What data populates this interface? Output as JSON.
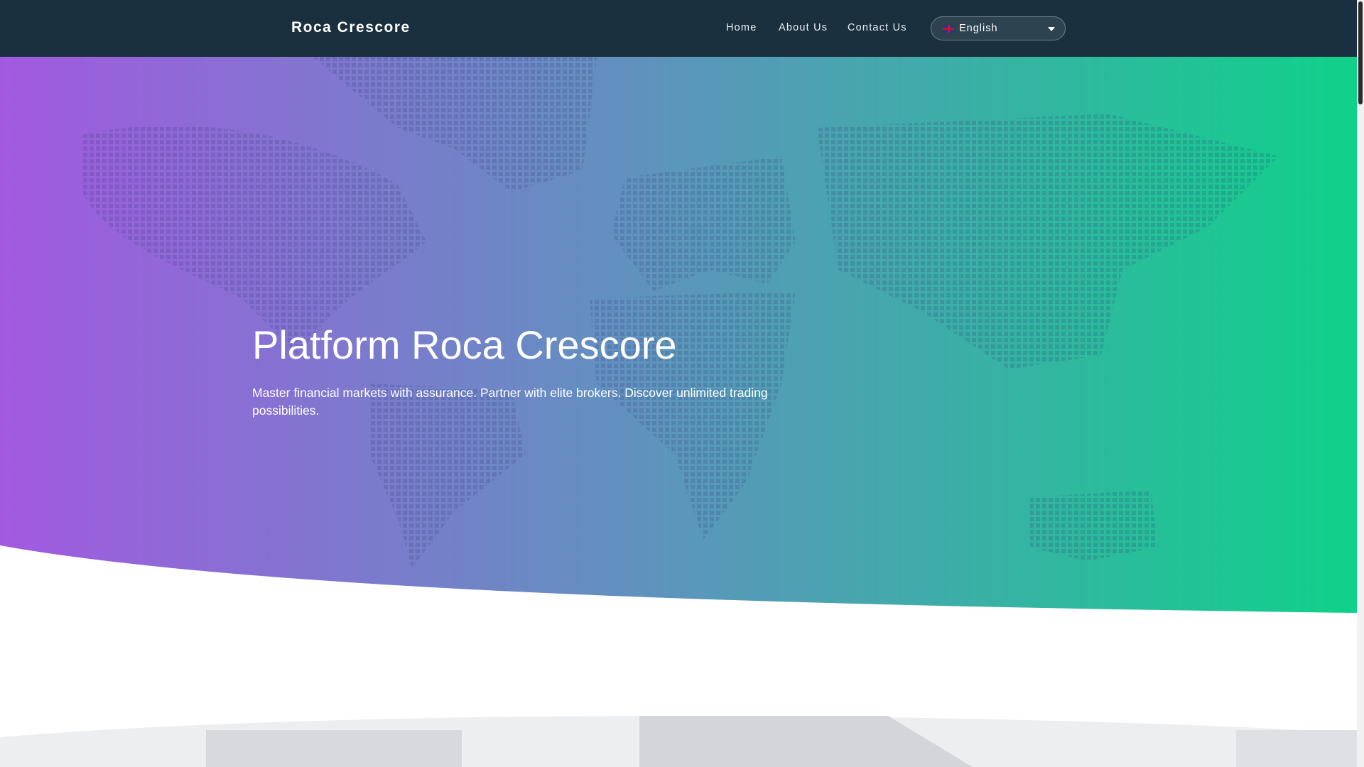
{
  "header": {
    "logo": "Roca Crescore",
    "nav": [
      "Home",
      "About Us",
      "Contact Us"
    ],
    "language": "English"
  },
  "hero": {
    "title": "Platform Roca Crescore",
    "subtitle": "Master financial markets with assurance. Partner with elite brokers. Discover unlimited trading possibilities."
  },
  "colors": {
    "nav": "#1b303e",
    "gradient_start": "#a259e0",
    "gradient_end": "#0fd18a"
  }
}
